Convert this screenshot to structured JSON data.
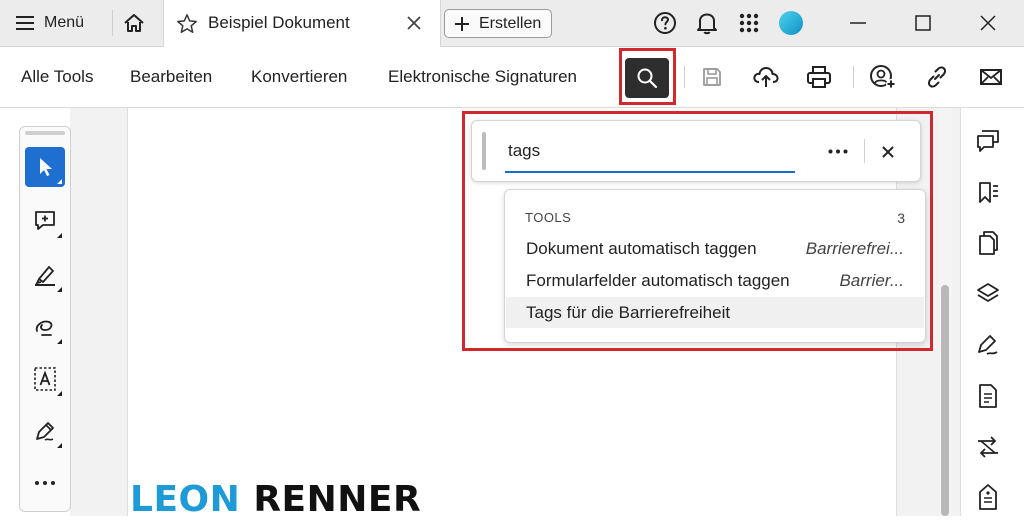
{
  "titlebar": {
    "menu_label": "Menü",
    "document_tab_title": "Beispiel Dokument",
    "create_label": "Erstellen"
  },
  "toolbar": {
    "menu_items": [
      "Alle Tools",
      "Bearbeiten",
      "Konvertieren",
      "Elektronische Signaturen"
    ]
  },
  "search": {
    "query": "tags",
    "results_header": "TOOLS",
    "results_count": "3",
    "results": [
      {
        "label": "Dokument automatisch taggen",
        "category": "Barrierefrei..."
      },
      {
        "label": "Formularfelder automatisch taggen",
        "category": "Barrier..."
      },
      {
        "label": "Tags für die Barrierefreiheit",
        "category": ""
      }
    ]
  },
  "document": {
    "brand_part1": "LEON",
    "brand_part2": "RENNER"
  },
  "icons": {
    "titlebar": [
      "hamburger-icon",
      "home-icon",
      "star-icon",
      "close-icon",
      "plus-icon",
      "help-icon",
      "bell-icon",
      "apps-grid-icon",
      "profile-avatar"
    ],
    "toolbar": [
      "search-icon",
      "save-icon",
      "cloud-upload-icon",
      "print-icon",
      "share-user-icon",
      "link-icon",
      "email-icon"
    ],
    "left_panel": [
      "select-cursor-icon",
      "add-comment-icon",
      "highlight-pen-icon",
      "freehand-draw-icon",
      "text-recognition-icon",
      "sign-pen-icon",
      "more-icon"
    ],
    "right_rail": [
      "comments-icon",
      "bookmarks-icon",
      "pages-icon",
      "layers-icon",
      "signature-icon",
      "document-properties-icon",
      "compare-icon",
      "accessibility-tags-icon"
    ]
  },
  "colors": {
    "accent_blue": "#1f6fd1",
    "highlight_red": "#d0282f",
    "brand_blue": "#1e9ad6",
    "avatar_teal": "#19b3d6"
  }
}
